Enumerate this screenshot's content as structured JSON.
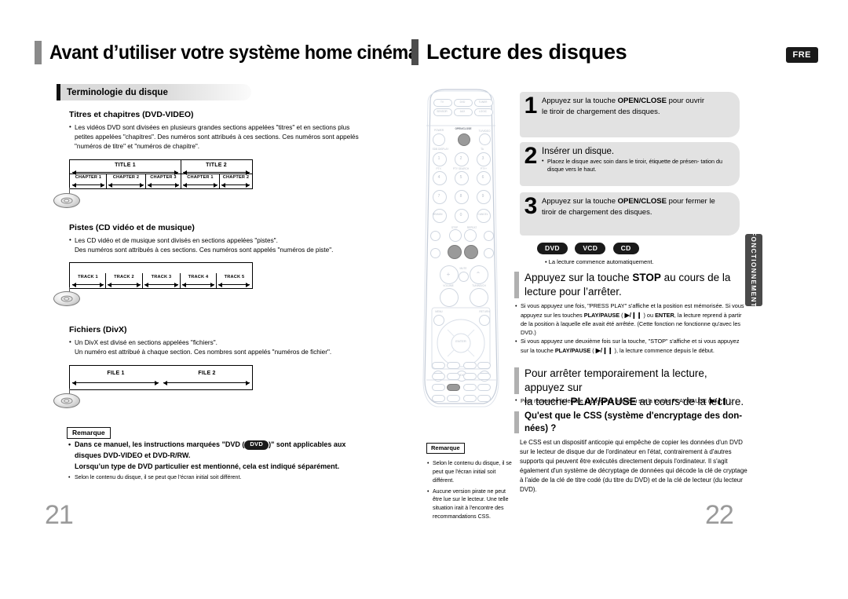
{
  "left_page": {
    "title": "Avant d’utiliser votre système home cinéma",
    "section_title": "Terminologie du disque",
    "blocks": [
      {
        "heading": "Titres et chapitres (DVD-VIDEO)",
        "bullet": "Les vidéos DVD sont divisées en plusieurs grandes sections appelées \"titres\" et en sections plus petites appelées \"chapitres\". Des numéros sont attribués à ces sections. Ces numéros sont appelés \"numéros de titre\" et \"numéros de chapitre\"."
      },
      {
        "heading": "Pistes (CD vidéo et de musique)",
        "bullet": "Les CD vidéo et de musique sont divisés en sections appelées \"pistes\".",
        "bullet2": "Des numéros sont attribués à ces sections. Ces numéros sont appelés \"numéros de piste\"."
      },
      {
        "heading": "Fichiers (DivX)",
        "bullet": "Un DivX est divisé en sections appelées \"fichiers\".",
        "bullet2": "Un numéro est attribué à chaque section. Ces nombres sont appelés \"numéros de fichier\"."
      }
    ],
    "diagram_titles": {
      "titles": [
        "TITLE 1",
        "TITLE 2"
      ],
      "chapters_t1": [
        "CHAPTER 1",
        "CHAPTER 2",
        "CHAPTER 3"
      ],
      "chapters_t2": [
        "CHAPTER 1",
        "CHAPTER 2"
      ],
      "tracks": [
        "TRACK 1",
        "TRACK 2",
        "TRACK 3",
        "TRACK 4",
        "TRACK 5"
      ],
      "files": [
        "FILE 1",
        "FILE 2"
      ]
    },
    "note": {
      "label": "Remarque",
      "line1_a": "Dans ce manuel, les instructions marquées \"DVD (",
      "badge": "DVD",
      "line1_b": ")\" sont applicables aux",
      "line2": "disques DVD-VIDEO et DVD-R/RW.",
      "line3": "Lorsqu’un type de DVD particulier est mentionné, cela est indiqué séparément.",
      "line4": "Selon le contenu du disque, il se peut que l’écran initial soit différent."
    },
    "page_number": "21"
  },
  "right_page": {
    "title": "Lecture des disques",
    "lang_badge": "FRE",
    "side_tab": "FONCTIONNEMENT",
    "steps": [
      {
        "number": "1",
        "text_a": "Appuyez sur la touche ",
        "bold": "OPEN/CLOSE",
        "text_b": " pour ouvrir",
        "line2": "le tiroir de chargement des disques."
      },
      {
        "number": "2",
        "title": "Insérer un disque.",
        "sub": "Placez le disque avec soin dans le tiroir, étiquette de présen- tation du disque vers le haut."
      },
      {
        "number": "3",
        "text_a": "Appuyez sur la touche ",
        "bold": "OPEN/CLOSE",
        "text_b": " pour fermer le",
        "line2": "tiroir de chargement des disques."
      }
    ],
    "disc_badges": [
      "DVD",
      "VCD",
      "CD"
    ],
    "auto_play_note": "La lecture commence automatiquement.",
    "stop_section": {
      "text_a": "Appuyez sur la touche ",
      "bold": "STOP",
      "text_b": " au cours de la",
      "line2": "lecture pour l’arrêter.",
      "b1_p1": "Si vous appuyez une fois, \"PRESS PLAY\" s'affiche et la position est mémorisée. Si vous appuyez sur les touches ",
      "b1_bold1": "PLAY/PAUSE",
      "b1_icon": "▶/❙❙",
      "b1_p2": " ) ou ",
      "b1_bold2": "ENTER",
      "b1_p3": ", la lecture reprend à partir de la position à laquelle elle avait été arrêtée. (Cette fonction ne fonctionne qu'avec les DVD.)",
      "b2_p1": "Si vous appuyez une deuxième fois sur la touche, \"STOP\" s'affiche et si vous appuyez sur la touche ",
      "b2_bold": "PLAY/PAUSE",
      "b2_p2": ", la lecture commence depuis le début."
    },
    "pause_section": {
      "text_a": "Pour arrêter temporairement la lecture, appuyez sur",
      "line2_a": "la touche ",
      "bold": "PLAY/PAUSE",
      "line2_b": " au cours de la lecture.",
      "note": "Pour reprendre la lecture appuyez de nouveau sur la touche PLAY/PAUSE ("
    },
    "css_section": {
      "heading_line1": "Qu'est que le CSS (système d'encryptage des don-",
      "heading_line2": "nées) ?",
      "body": "Le CSS est un dispositif anticopie qui empêche de copier les données d'un DVD sur le lecteur de disque dur de l'ordinateur en l'état, contrairement à d'autres supports qui peuvent être exécutés directement depuis l'ordinateur. Il s'agit également d'un système de décryptage de données qui décode la clé de cryptage à l'aide de la clé de titre codé (du titre du DVD) et de la clé de lecteur (du lecteur DVD)."
    },
    "note": {
      "label": "Remarque",
      "b1": "Selon le contenu du disque, il se peut que l'écran initial soit différent.",
      "b2": "Aucune version pirate ne peut être lue sur le lecteur. Une telle situation irait à l'encontre des recommandations CSS."
    },
    "page_number": "22"
  },
  "remote": {
    "top_buttons": [
      "TV",
      "DVD",
      "TUNER",
      "SENSOR",
      "AUX",
      "LOGIC"
    ],
    "labels": [
      "POWER",
      "OPEN/CLOSE",
      "TV/VIDEO",
      "SDB DISPLAY",
      "TA",
      "PTY-",
      "PTY SEARCH",
      "PTY+",
      "REMAIN",
      "CANCEL",
      "STEP",
      "REPEAT",
      "MUTE",
      "VOLUME",
      "TUNING/CH",
      "MENU",
      "RETURN",
      "ENTER",
      "INFO",
      "AUDIO",
      "SUBTITLE",
      "DIMMER",
      "SOUND EDIT"
    ],
    "numbers": [
      "1",
      "2",
      "3",
      "4",
      "5",
      "6",
      "7",
      "8",
      "9",
      "0"
    ]
  },
  "colors": {
    "accent_grey": "#8a8a8a",
    "step_bg": "#e2e2e2",
    "badge_black": "#1a1a1a",
    "tab_grey": "#4a4a4a",
    "page_num": "#9a9a9a"
  }
}
